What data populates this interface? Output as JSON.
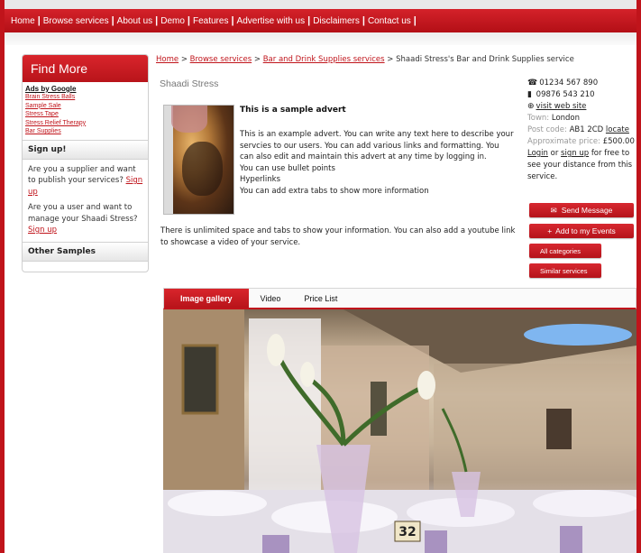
{
  "nav": {
    "items": [
      "Home",
      "Browse services",
      "About us",
      "Demo",
      "Features",
      "Advertise with us",
      "Disclaimers",
      "Contact us"
    ],
    "separator": "|"
  },
  "sidebar": {
    "title": "Find More",
    "ads_title": "Ads by Google",
    "ads": [
      "Brain Stress Balls",
      "Sample Sale",
      "Stress Tape",
      "Stress Relief Therapy",
      "Bar Supplies"
    ],
    "signup_heading": "Sign up!",
    "supplier_text": "Are you a supplier and want to publish your services?",
    "supplier_link": "Sign up",
    "user_text": "Are you a user and want to manage your Shaadi Stress?",
    "user_link": "Sign up",
    "other_heading": "Other Samples"
  },
  "breadcrumb": {
    "home": "Home",
    "sep": ">",
    "browse": "Browse services",
    "category": "Bar and Drink Supplies services",
    "current": "Shaadi Stress's Bar and Drink Supplies service"
  },
  "business": {
    "name": "Shaadi Stress"
  },
  "advert": {
    "title": "This is a sample advert",
    "lines": [
      "This is an example advert. You can write any text here to describe your",
      "servcies to our users.  You can add various links and formatting. You",
      "can also edit and maintain this advert at any time by logging in.",
      "You can use bullet points",
      "Hyperlinks",
      "You can add extra tabs to show more information"
    ],
    "more_lines": [
      "There is unlimited space and tabs to show your information. You can also add a youtube link",
      "to showcase a video of your service."
    ]
  },
  "contact": {
    "phone": "01234 567 890",
    "mobile": "09876 543 210",
    "website": "visit web site",
    "town_label": "Town:",
    "town": "London",
    "postcode_label": "Post code:",
    "postcode": "AB1 2CD",
    "locate": "locate",
    "price_label": "Approximate price:",
    "price": "£500.00",
    "login": "Login",
    "or": "or",
    "signup": "sign up",
    "distance_text_1": "for free to",
    "distance_text_2": "see your distance from this",
    "distance_text_3": "service."
  },
  "buttons": {
    "send_message": "Send Message",
    "add_events": "Add to my Events",
    "all_categories": "All categories",
    "similar_services": "Similar services"
  },
  "tabs": [
    "Image gallery",
    "Video",
    "Price List"
  ],
  "gallery": {
    "table_number": "32"
  },
  "colors": {
    "brand_red": "#c0141b",
    "link_red": "#c0141b"
  },
  "icons": {
    "phone": "phone-icon",
    "mobile": "mobile-icon",
    "globe": "globe-icon",
    "mail": "envelope-icon",
    "plus": "plus-icon"
  }
}
